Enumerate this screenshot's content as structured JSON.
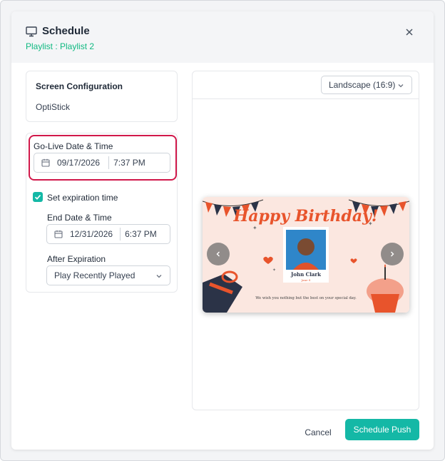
{
  "header": {
    "title": "Schedule",
    "subtitle": "Playlist : Playlist 2"
  },
  "screen_config": {
    "title": "Screen Configuration",
    "value": "OptiStick"
  },
  "golive": {
    "label": "Go-Live Date & Time",
    "date": "09/17/2026",
    "time": "7:37 PM"
  },
  "expiration": {
    "checkbox_label": "Set expiration time",
    "checked": true,
    "end_label": "End Date & Time",
    "end_date": "12/31/2026",
    "end_time": "6:37 PM",
    "after_label": "After Expiration",
    "after_value": "Play Recently Played"
  },
  "preview": {
    "orientation": "Landscape (16:9)",
    "slide_heading": "Happy Birthday!",
    "slide_name": "John Clark",
    "slide_subname": "Jane S",
    "slide_message": "We wish you nothing but the best on your special day."
  },
  "footer": {
    "cancel_label": "Cancel",
    "push_label": "Schedule Push"
  },
  "colors": {
    "accent": "#14b8a6",
    "subtitle": "#10b981",
    "highlight": "#d1184a"
  }
}
